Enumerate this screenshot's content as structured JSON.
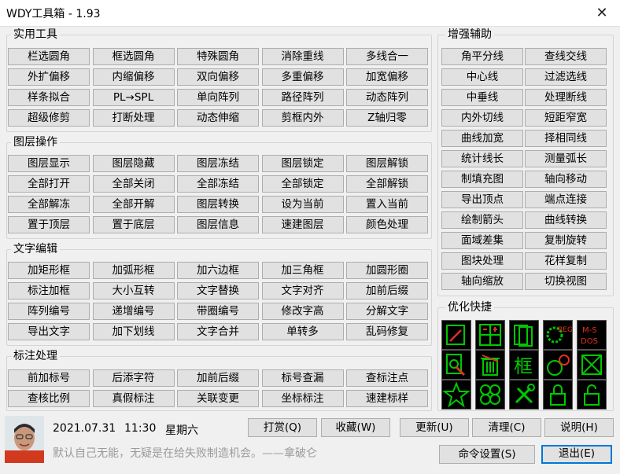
{
  "window": {
    "title": "WDY工具箱 - 1.93",
    "close_glyph": "✕"
  },
  "groups": {
    "practical": {
      "label": "实用工具",
      "buttons": [
        "栏选圆角",
        "框选圆角",
        "特殊圆角",
        "消除重线",
        "多线合一",
        "外扩偏移",
        "内缩偏移",
        "双向偏移",
        "多重偏移",
        "加宽偏移",
        "样条拟合",
        "PL→SPL",
        "单向阵列",
        "路径阵列",
        "动态阵列",
        "超级修剪",
        "打断处理",
        "动态伸缩",
        "剪框内外",
        "Z轴归零"
      ]
    },
    "layers": {
      "label": "图层操作",
      "buttons": [
        "图层显示",
        "图层隐藏",
        "图层冻结",
        "图层锁定",
        "图层解锁",
        "全部打开",
        "全部关闭",
        "全部冻结",
        "全部锁定",
        "全部解锁",
        "全部解冻",
        "全部开解",
        "图层转换",
        "设为当前",
        "置入当前",
        "置于顶层",
        "置于底层",
        "图层信息",
        "速建图层",
        "颜色处理"
      ]
    },
    "text": {
      "label": "文字编辑",
      "buttons": [
        "加矩形框",
        "加弧形框",
        "加六边框",
        "加三角框",
        "加圆形圈",
        "标注加框",
        "大小互转",
        "文字替换",
        "文字对齐",
        "加前后缀",
        "阵列编号",
        "递增编号",
        "带圈编号",
        "修改字高",
        "分解文字",
        "导出文字",
        "加下划线",
        "文字合并",
        "单转多",
        "乱码修复"
      ]
    },
    "dims": {
      "label": "标注处理",
      "buttons": [
        "前加标号",
        "后添字符",
        "加前后缀",
        "标号查漏",
        "查标注点",
        "查核比例",
        "真假标注",
        "关联变更",
        "坐标标注",
        "速建标样"
      ]
    },
    "assist": {
      "label": "增强辅助",
      "buttons": [
        "角平分线",
        "查线交线",
        "中心线",
        "过滤选线",
        "中垂线",
        "处理断线",
        "内外切线",
        "短距窄宽",
        "曲线加宽",
        "择相同线",
        "统计线长",
        "测量弧长",
        "制填充图",
        "轴向移动",
        "导出顶点",
        "端点连接",
        "绘制箭头",
        "曲线转换",
        "面域差集",
        "复制旋转",
        "图块处理",
        "花样复制",
        "轴向缩放",
        "切换视图"
      ]
    },
    "shortcuts": {
      "label": "优化快捷",
      "icons": [
        "edit-shape-icon",
        "grid-calc-icon",
        "layers-stack-icon",
        "reg-icon",
        "msdos-icon",
        "attach-icon",
        "trash-icon",
        "frame-char-icon",
        "link-circles-icon",
        "x-box-icon",
        "star-icon",
        "circles-cluster-icon",
        "tools-icon",
        "lock-icon",
        "unlock-icon"
      ]
    }
  },
  "footer": {
    "date": "2021.07.31",
    "time": "11:30",
    "weekday": "星期六",
    "quote": "默认自己无能，无疑是在给失败制造机会。——拿破仑",
    "buttons": {
      "donate": "打赏(Q)",
      "favorite": "收藏(W)",
      "update": "更新(U)",
      "clean": "清理(C)",
      "help": "说明(H)",
      "settings": "命令设置(S)",
      "exit": "退出(E)"
    }
  },
  "colors": {
    "icon_green": "#00c800",
    "icon_red": "#e03020",
    "focus_border": "#0078d7"
  }
}
